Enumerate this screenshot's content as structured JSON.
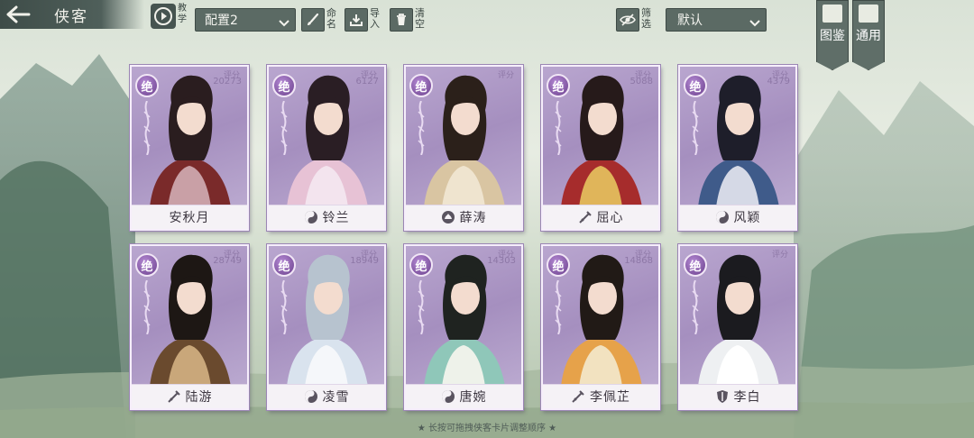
{
  "header": {
    "title": "侠客",
    "tutorial_label": "教学",
    "config_value": "配置2",
    "rename_label": "命名",
    "import_label": "导入",
    "clear_label": "清空",
    "filter_label": "筛选",
    "sort_value": "默认",
    "codex_tab": "图鉴",
    "general_tab": "通用"
  },
  "cards": [
    {
      "name": "安秋月",
      "rank": "绝",
      "score_label": "评分",
      "score": "20273",
      "class_icon": "none",
      "theme": "red"
    },
    {
      "name": "铃兰",
      "rank": "绝",
      "score_label": "评分",
      "score": "6127",
      "class_icon": "taiji-icon",
      "theme": "pink"
    },
    {
      "name": "薛涛",
      "rank": "绝",
      "score_label": "评分",
      "score": "",
      "class_icon": "lotus-icon",
      "theme": "cream"
    },
    {
      "name": "屈心",
      "rank": "绝",
      "score_label": "评分",
      "score": "5088",
      "class_icon": "sword-icon",
      "theme": "crimson"
    },
    {
      "name": "风颖",
      "rank": "绝",
      "score_label": "评分",
      "score": "4379",
      "class_icon": "taiji-icon",
      "theme": "blue"
    },
    {
      "name": "陆游",
      "rank": "绝",
      "score_label": "评分",
      "score": "28749",
      "class_icon": "sword-icon",
      "theme": "brown"
    },
    {
      "name": "凌雪",
      "rank": "绝",
      "score_label": "评分",
      "score": "18949",
      "class_icon": "taiji-icon",
      "theme": "ice"
    },
    {
      "name": "唐婉",
      "rank": "绝",
      "score_label": "评分",
      "score": "14303",
      "class_icon": "taiji-icon",
      "theme": "teal"
    },
    {
      "name": "李佩芷",
      "rank": "绝",
      "score_label": "评分",
      "score": "14868",
      "class_icon": "sword-icon",
      "theme": "gold"
    },
    {
      "name": "李白",
      "rank": "绝",
      "score_label": "评分",
      "score": "",
      "class_icon": "shield-icon",
      "theme": "white"
    }
  ],
  "footer": {
    "hint": "★ 长按可拖拽侠客卡片调整顺序 ★"
  },
  "colors": {
    "card_bg": "#a58fbf",
    "rank_badge": "#6a3f8c",
    "toolbar": "#5b6a64"
  }
}
